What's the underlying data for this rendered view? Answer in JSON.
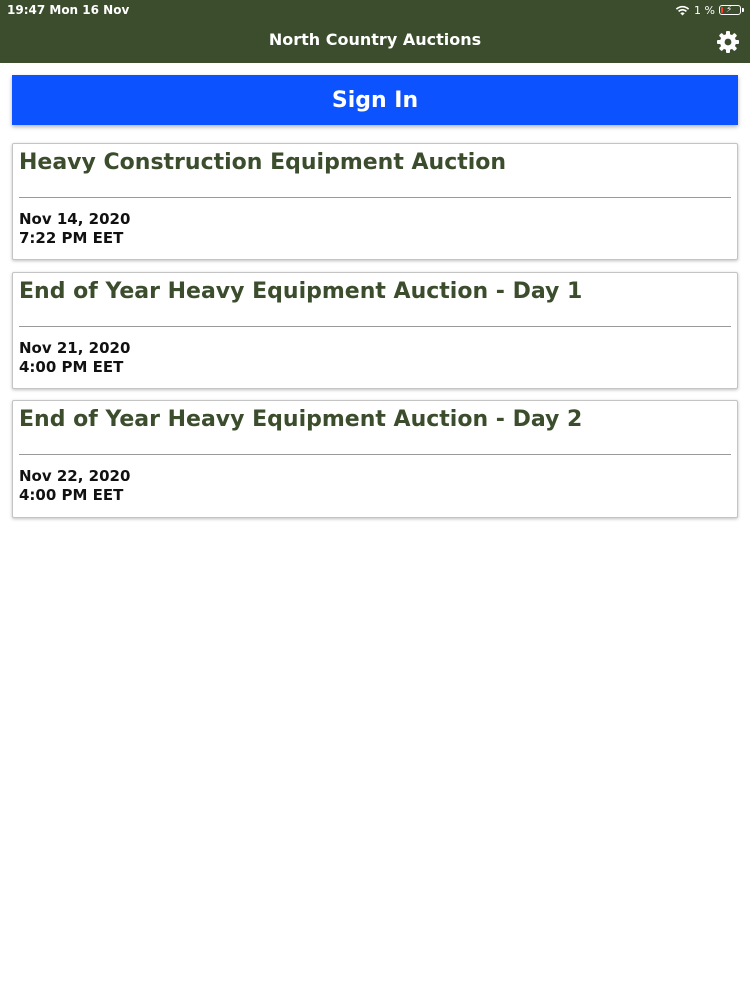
{
  "status_bar": {
    "time_date": "19:47   Mon 16 Nov",
    "battery_percent": "1 %",
    "icons": [
      "wifi-icon",
      "battery-charging-icon"
    ]
  },
  "header": {
    "title": "North Country Auctions",
    "settings_icon": "gear-icon"
  },
  "sign_in": {
    "label": "Sign In"
  },
  "auctions": [
    {
      "title": "Heavy Construction Equipment Auction",
      "date": "Nov 14, 2020",
      "time": "7:22 PM EET"
    },
    {
      "title": "End of Year Heavy Equipment Auction - Day 1",
      "date": "Nov 21, 2020",
      "time": "4:00 PM EET"
    },
    {
      "title": "End of Year Heavy Equipment Auction - Day 2",
      "date": "Nov 22, 2020",
      "time": "4:00 PM EET"
    }
  ],
  "colors": {
    "header_bg": "#3b4d2c",
    "title_green": "#3b4d2c",
    "sign_in_blue": "#0d52ff",
    "battery_low": "#ff3b30"
  }
}
